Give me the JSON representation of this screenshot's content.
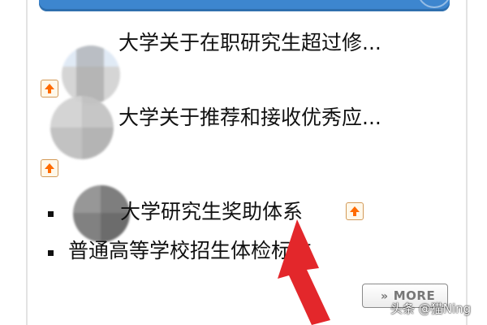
{
  "list": {
    "items": [
      {
        "title": "大学关于在职研究生超过修..."
      },
      {
        "title": "大学关于推荐和接收优秀应..."
      },
      {
        "title": "大学研究生奖助体系"
      },
      {
        "title": "普通高等学校招生体检标准"
      }
    ]
  },
  "more_button": {
    "label": "MORE",
    "icon": "double-chevron-right-icon"
  },
  "watermark": {
    "text": "头条 @猫Ning"
  },
  "colors": {
    "header_blue": "#3d86cf",
    "arrow_orange": "#ff6b00",
    "annotation_red": "#e3272b"
  }
}
